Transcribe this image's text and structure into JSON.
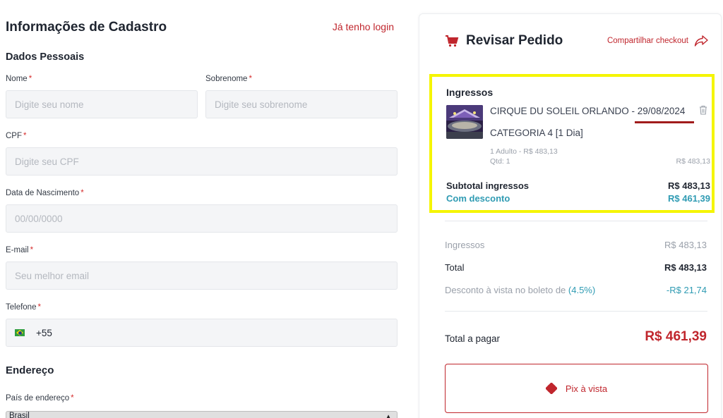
{
  "form": {
    "title": "Informações de Cadastro",
    "login_link": "Já tenho login",
    "personal_section": "Dados Pessoais",
    "first_name": {
      "label": "Nome",
      "placeholder": "Digite seu nome"
    },
    "last_name": {
      "label": "Sobrenome",
      "placeholder": "Digite seu sobrenome"
    },
    "cpf": {
      "label": "CPF",
      "placeholder": "Digite seu CPF"
    },
    "birth_date": {
      "label": "Data de Nascimento",
      "placeholder": "00/00/0000"
    },
    "email": {
      "label": "E-mail",
      "placeholder": "Seu melhor email"
    },
    "phone": {
      "label": "Telefone",
      "value": "+55",
      "flag_icon": "brazil-flag-icon"
    },
    "required_mark": "*",
    "address_section": "Endereço",
    "country": {
      "label": "País de endereço",
      "value": "Brasil"
    }
  },
  "summary": {
    "title": "Revisar Pedido",
    "share_link": "Compartilhar checkout",
    "tickets_title": "Ingressos",
    "event": {
      "name": "CIRQUE DU SOLEIL ORLANDO - 29/08/2024",
      "category": "CATEGORIA 4 [1 Dia]",
      "detail": "1 Adulto - R$ 483,13",
      "quantity": "Qtd: 1",
      "price": "R$ 483,13"
    },
    "subtotal_label": "Subtotal ingressos",
    "subtotal_value": "R$ 483,13",
    "discount_label": "Com desconto",
    "discount_value": "R$ 461,39",
    "breakdown": {
      "tickets_label": "Ingressos",
      "tickets_value": "R$ 483,13",
      "total_label": "Total",
      "total_value": "R$ 483,13",
      "cash_discount_label": "Desconto à vista no boleto de",
      "cash_discount_pct": "(4.5%)",
      "cash_discount_value": "-R$ 21,74"
    },
    "total_pay_label": "Total a pagar",
    "total_pay_value": "R$ 461,39",
    "pix_button": "Pix à vista"
  },
  "colors": {
    "brand_red": "#c0262d",
    "discount_teal": "#2f9bb3",
    "highlight_yellow": "#f5f500"
  }
}
